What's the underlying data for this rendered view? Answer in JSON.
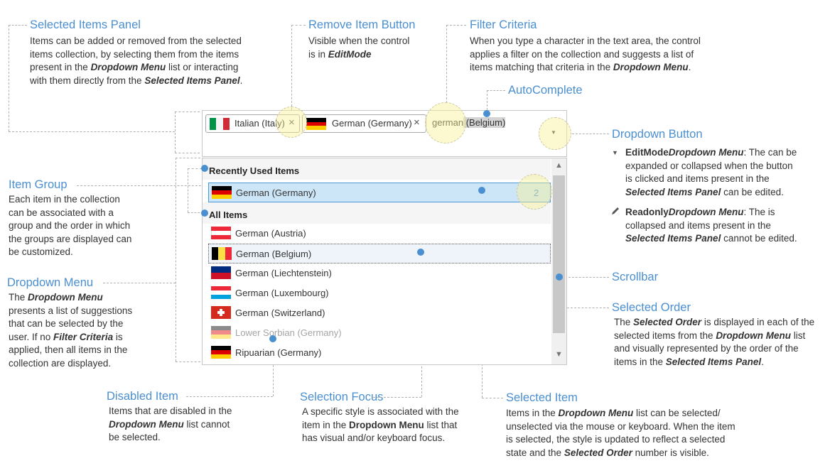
{
  "annotations": {
    "selected_items_panel": {
      "title": "Selected Items Panel",
      "desc": [
        {
          "t": "Items can be added or removed from the selected"
        },
        {
          "t": "items collection, by selecting them from the items"
        },
        {
          "t": "present in the ",
          "b": "Dropdown Menu",
          "a": " list or interacting"
        },
        {
          "t": "with them directly from the ",
          "b": "Selected Items Panel",
          "a": "."
        }
      ]
    },
    "remove_item_button": {
      "title": "Remove Item Button",
      "desc": [
        {
          "t": "Visible when the control"
        },
        {
          "t": "is in ",
          "b": "EditMode",
          "a": ""
        }
      ]
    },
    "filter_criteria": {
      "title": "Filter Criteria",
      "desc": [
        {
          "t": "When you type a character in the text area, the control"
        },
        {
          "t": "applies a filter on the collection and suggests a list of"
        },
        {
          "t": "items matching that criteria in the ",
          "b": "Dropdown Menu",
          "a": "."
        }
      ]
    },
    "autocomplete": {
      "title": "AutoComplete"
    },
    "dropdown_button": {
      "title": "Dropdown Button",
      "editmode": [
        {
          "t": "",
          "b2": "EditMode",
          "a": ": The ",
          "b": "Dropdown Menu",
          "a2": " can be"
        },
        {
          "t": "expanded or collapsed when the button"
        },
        {
          "t": "is clicked and items present in the"
        },
        {
          "t": "",
          "b": "Selected Items Panel",
          "a": " can be edited."
        }
      ],
      "readonly": [
        {
          "t": "",
          "b2": "Readonly",
          "a": ": The ",
          "b": "Dropdown Menu",
          "a2": " is"
        },
        {
          "t": "collapsed and items present in the"
        },
        {
          "t": "",
          "b": "Selected Items Panel",
          "a": " cannot be edited."
        }
      ]
    },
    "item_group": {
      "title": "Item Group",
      "desc": [
        {
          "t": "Each item in the collection"
        },
        {
          "t": "can be associated with a"
        },
        {
          "t": "group and the order in which"
        },
        {
          "t": "the groups are displayed can"
        },
        {
          "t": "be customized."
        }
      ]
    },
    "dropdown_menu": {
      "title": "Dropdown Menu",
      "desc": [
        {
          "t": "The ",
          "b": "Dropdown Menu",
          "a": ""
        },
        {
          "t": "presents a list of suggestions"
        },
        {
          "t": "that can be selected by the"
        },
        {
          "t": "user.  If no ",
          "b": "Filter Criteria",
          "a": " is"
        },
        {
          "t": "applied, then all items in the"
        },
        {
          "t": "collection are displayed."
        }
      ]
    },
    "scrollbar": {
      "title": "Scrollbar"
    },
    "selected_order": {
      "title": "Selected Order",
      "desc": [
        {
          "t": "The ",
          "b": "Selected Order",
          "a": " is displayed in each of the"
        },
        {
          "t": "selected items from the ",
          "b": "Dropdown Menu",
          "a": " list"
        },
        {
          "t": "and visually represented by the order of the"
        },
        {
          "t": "items in the ",
          "b": "Selected Items Panel",
          "a": "."
        }
      ]
    },
    "disabled_item": {
      "title": "Disabled Item",
      "desc": [
        {
          "t": "Items that are disabled in the"
        },
        {
          "t": "",
          "b": "Dropdown Menu",
          "a": " list cannot"
        },
        {
          "t": "be selected."
        }
      ]
    },
    "selection_focus": {
      "title": "Selection Focus",
      "desc": [
        {
          "t": "A specific style is associated with the"
        },
        {
          "t": "item in the ",
          "b3": "Dropdown Menu",
          "a": " list that"
        },
        {
          "t": "has visual and/or keyboard focus."
        }
      ]
    },
    "selected_item": {
      "title": "Selected Item",
      "desc": [
        {
          "t": "Items in the ",
          "b": "Dropdown Menu",
          "a": " list can be selected/"
        },
        {
          "t": "unselected via the mouse or keyboard.  When the item"
        },
        {
          "t": "is selected, the style is updated to reflect a selected"
        },
        {
          "t": "state and the ",
          "b": "Selected Order",
          "a": " number is visible."
        }
      ]
    }
  },
  "control": {
    "chips": [
      {
        "label": "Italian (Italy)",
        "flag": "italy",
        "remove": "×"
      },
      {
        "label": "German (Germany)",
        "flag": "germany",
        "remove": "×"
      }
    ],
    "input_text": "german",
    "autocomplete_text": " (Belgium)",
    "dropdown_icon": "▼"
  },
  "dropdown": {
    "groups": [
      {
        "name": "Recently Used Items"
      },
      {
        "name": "All Items"
      }
    ],
    "recent_items": [
      {
        "label": "German (Germany)",
        "flag": "germany",
        "order": "2"
      }
    ],
    "all_items": [
      {
        "label": "German (Austria)",
        "flag": "austria"
      },
      {
        "label": "German (Belgium)",
        "flag": "belgium"
      },
      {
        "label": "German (Liechtenstein)",
        "flag": "liechtenstein"
      },
      {
        "label": "German (Luxembourg)",
        "flag": "luxembourg"
      },
      {
        "label": "German (Switzerland)",
        "flag": "switzerland"
      },
      {
        "label": "Lower Sorbian (Germany)",
        "flag": "germany",
        "disabled": true
      },
      {
        "label": "Ripuarian (Germany)",
        "flag": "germany"
      }
    ],
    "scroll_up": "▲",
    "scroll_down": "▼"
  },
  "colors": {
    "accent": "#4a8fd0",
    "selected_bg": "#cde6f7",
    "selected_border": "#4a9ad8"
  }
}
